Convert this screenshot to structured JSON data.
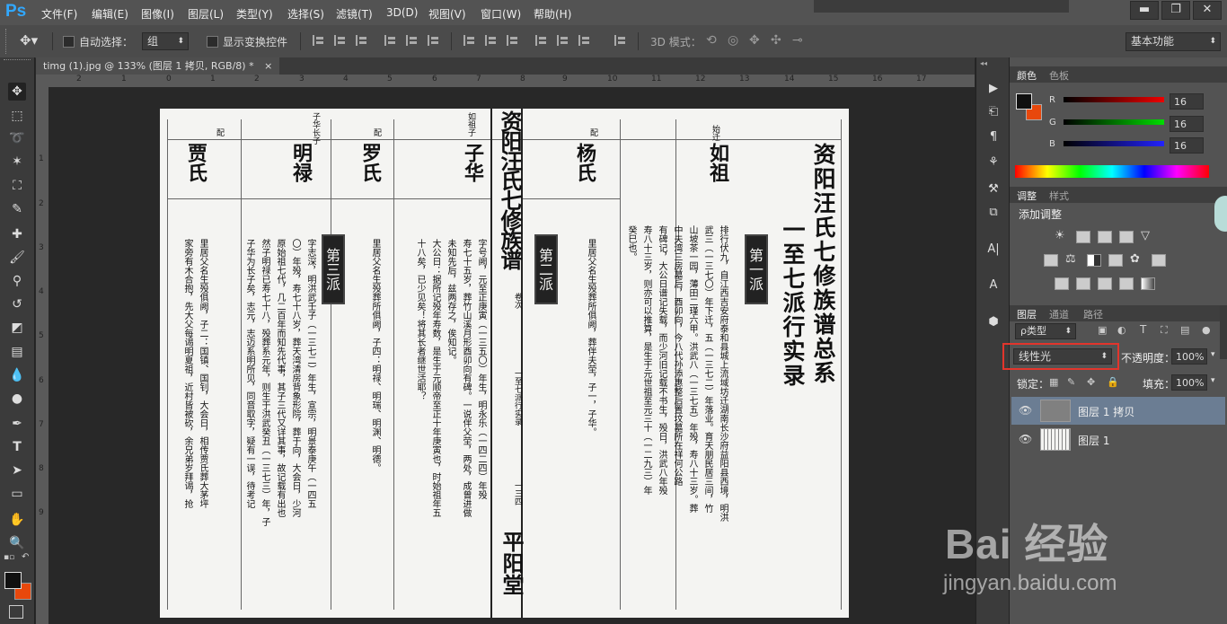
{
  "app": {
    "logo": "Ps"
  },
  "menu": [
    "文件(F)",
    "编辑(E)",
    "图像(I)",
    "图层(L)",
    "类型(Y)",
    "选择(S)",
    "滤镜(T)",
    "3D(D)",
    "视图(V)",
    "窗口(W)",
    "帮助(H)"
  ],
  "window_controls": {
    "minimize": "▬",
    "restore": "❐",
    "close": "✕"
  },
  "options": {
    "auto_select_label": "自动选择：",
    "auto_select_value": "组",
    "show_transform_label": "显示变换控件",
    "mode3d_label": "3D 模式：",
    "workspace": "基本功能"
  },
  "document": {
    "tab_title": "timg (1).jpg @ 133% (图层 1 拷贝, RGB/8) *",
    "close": "×",
    "ruler_h": [
      "2",
      "1",
      "0",
      "1",
      "2",
      "3",
      "4",
      "5",
      "6",
      "7",
      "8",
      "9",
      "10",
      "11",
      "12",
      "13",
      "14",
      "15",
      "16",
      "17"
    ],
    "ruler_v": [
      "1",
      "2",
      "3",
      "4",
      "5",
      "6",
      "7",
      "8",
      "9"
    ],
    "page": {
      "right_title": "资阳汪氏七修族谱总系",
      "right_subtitle": "一至七派行实录",
      "badge_1": "第一派",
      "badge_2": "第二派",
      "badge_3": "第三派",
      "center_title": "资阳汪氏七修族谱",
      "center_vol": "卷次",
      "center_range": "一至七派行实录",
      "center_page": "一三四",
      "center_hall": "平阳堂",
      "name_rugu": "如祖",
      "name_yang": "杨氏",
      "name_zihua": "子华",
      "name_luo": "罗氏",
      "name_minglu": "明禄",
      "name_jia": "贾氏",
      "small_rugu": "始迁",
      "small_pei": "配",
      "small_zihua": "如祖子",
      "small_minglu": "子华长子",
      "text_1": "排行伏九，自江西吉安府泰和县城上流域坊迁湖南长沙府益阳县西境，明洪",
      "text_2": "武三（一三七〇）年下迁，五（一三七二）年落业。育天朋民居三间，竹",
      "text_3": "山坡茶一园，薄田二瑾六甲。洪武八（一三七五）年殁，寿八十三岁。葬",
      "text_4": "中夫湾三房墓后，酉卯向，今八代孙添惠整后置坟墓所在祥何公路",
      "text_5": "有碑记，大公日谱记失载，而少河旧记载不书生，殁日，洪武八年殁",
      "text_6": "寿八十三岁，则亦可以推算，是生于元世祖至元三十（一二九三）年",
      "text_7": "癸巳也。",
      "text_8": "里居父名生殁葬所俱阙，葬伴夫茔，子一，子华。",
      "text_9": "字号阙，元至正庚寅（一三五〇）年生，明永乐（一四二四）年殁",
      "text_10": "寿七十五岁，葬竹山溪月形酉卯向有碑。一说伴父茔，两处，成曾进做",
      "text_11": "未知先后，兹两存之，俟知记。",
      "text_12": "大公日：据所记殁年寿数，是生于元顺帝至正十年庚寅也，时始祖年五",
      "text_13": "十八矣，已少见矣！将其长者继世活耶？",
      "text_14": "里居父名生殁葬所俱阙，子四：明禄、明瑞、明渊、明德。",
      "text_15": "字志深，明洪武壬子（一三七二）年生，宣宗，明景泰庚午（一四五",
      "text_16": "〇）年殁，寿七十八岁，葬天湾清房背象形院，葬于向，大会日，少河",
      "text_17": "原始祖七代，几二百年而知先代事，其子三代又详其事，故记载有出也",
      "text_18": "然子明禄已寿七十八，殁葬系元年，则生于洪武癸丑（一三七三）年，子",
      "text_19": "子华为长子矣，志元，志迈系明所见，同音取字，疑有一误，待考记",
      "text_20": "里居父名生殁俱阙，子二：国镇、国钊，大会日，相传贾氏葬大茅坪",
      "text_21": "家旁有木合抱，先大父每谒明夏祖，近村皆被砍，余兄弟岁拜谒，抢"
    }
  },
  "panels": {
    "color_tabs": [
      "颜色",
      "色板"
    ],
    "rgb": {
      "r_label": "R",
      "g_label": "G",
      "b_label": "B",
      "r": "16",
      "g": "16",
      "b": "16"
    },
    "fg_color": "#101010",
    "bg_color": "#e8480c",
    "adjust_tabs": [
      "调整",
      "样式"
    ],
    "adjust_title": "添加调整",
    "layer_tabs": [
      "图层",
      "通道",
      "路径"
    ],
    "filter_kind": "ρ类型",
    "blend_mode": "线性光",
    "opacity_label": "不透明度：",
    "opacity": "100%",
    "lock_label": "锁定：",
    "fill_label": "填充：",
    "fill": "100%",
    "layers": [
      {
        "name": "图层 1 拷贝",
        "selected": true
      },
      {
        "name": "图层 1",
        "selected": false
      }
    ]
  },
  "watermark": {
    "logo": "Bai 经验",
    "url": "jingyan.baidu.com"
  }
}
